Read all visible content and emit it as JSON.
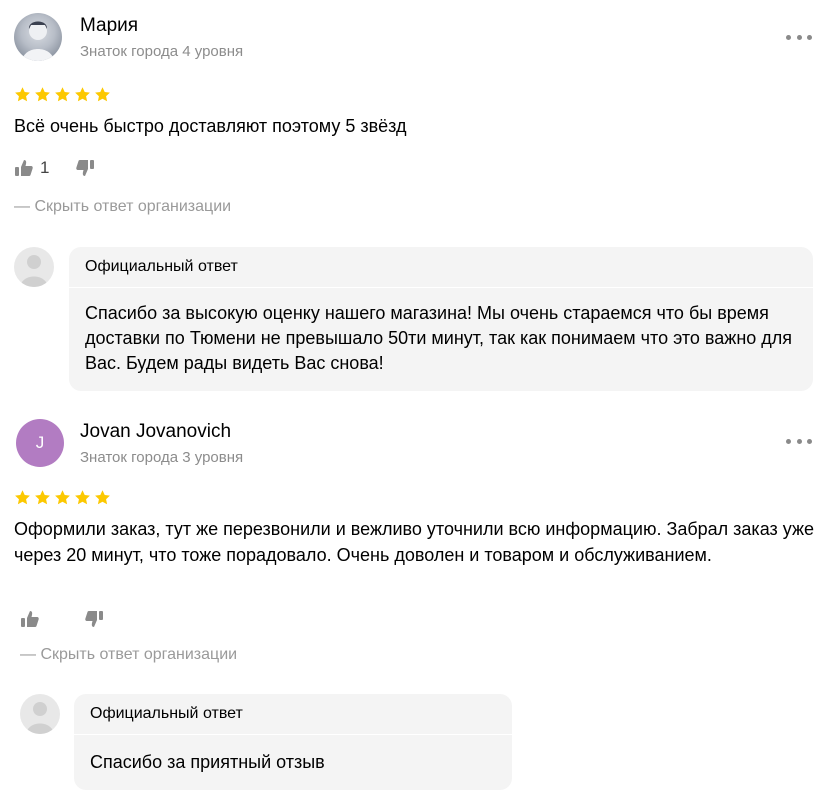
{
  "reviews": [
    {
      "author": "Мария",
      "level": "Знаток города 4 уровня",
      "avatar_type": "photo",
      "rating": 5,
      "text": "Всё очень быстро доставляют поэтому 5 звёзд",
      "likes": "1",
      "hide_label": "— Скрыть ответ организации",
      "answer_title": "Официальный ответ",
      "answer_text": "Спасибо за высокую оценку нашего магазина! Мы очень стараемся что бы время доставки по Тюмени не превышало 50ти минут, так как понимаем что это важно для Вас. Будем рады видеть Вас снова!"
    },
    {
      "author": "Jovan Jovanovich",
      "level": "Знаток города 3 уровня",
      "avatar_type": "letter",
      "avatar_letter": "J",
      "rating": 5,
      "text": "Оформили заказ, тут же перезвонили и вежливо уточнили всю информацию. Забрал заказ уже через 20 минут, что тоже порадовало. Очень доволен и товаром и обслуживанием.",
      "likes": "",
      "hide_label": "— Скрыть ответ организации",
      "answer_title": "Официальный ответ",
      "answer_text": "Спасибо за приятный отзыв"
    }
  ],
  "colors": {
    "star": "#fcc800",
    "avatar_letter_bg": "#b27cc2",
    "secondary_text": "#8c8c8c",
    "answer_bg": "#f4f4f4"
  },
  "icons": [
    "more-icon",
    "star-icon",
    "thumbs-up-icon",
    "thumbs-down-icon",
    "org-avatar-icon"
  ]
}
